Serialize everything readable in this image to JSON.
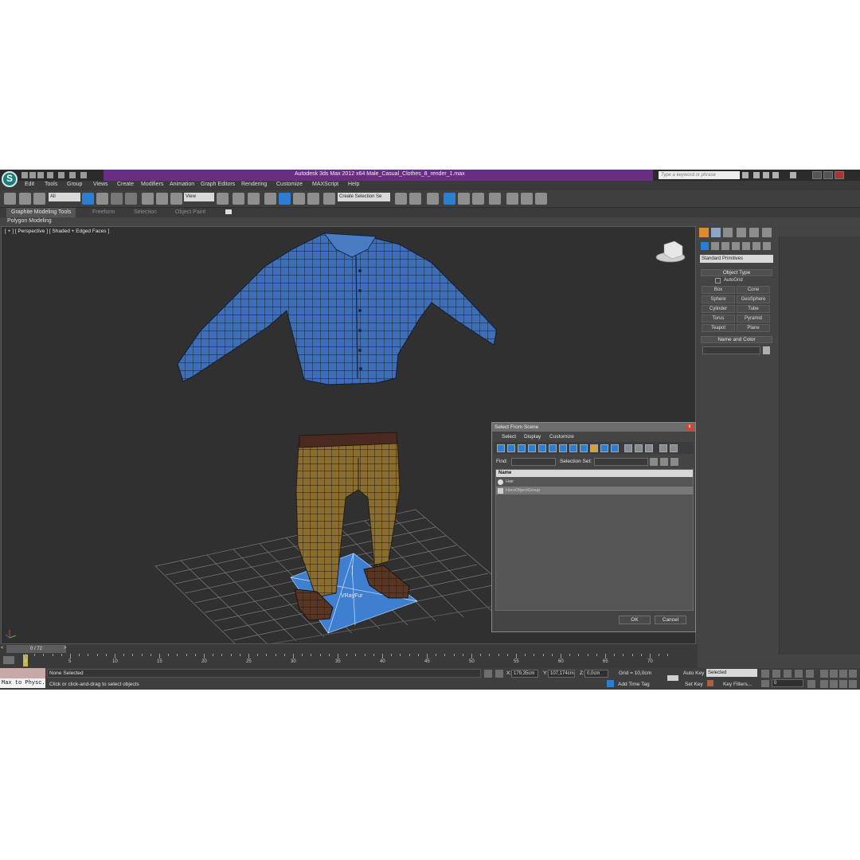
{
  "app": {
    "title": "Autodesk 3ds Max  2012 x64     Male_Casual_Clothes_8_render_1.max",
    "search_placeholder": "Type a keyword or phrase",
    "accent": "#6a2d86"
  },
  "menu": [
    "Edit",
    "Tools",
    "Group",
    "Views",
    "Create",
    "Modifiers",
    "Animation",
    "Graph Editors",
    "Rendering",
    "Customize",
    "MAXScript",
    "Help"
  ],
  "toolbar": {
    "filter_value": "All",
    "refcoord_value": "View",
    "selection_set_value": "Create Selection Se"
  },
  "ribbon": {
    "tabs": [
      "Graphite Modeling Tools",
      "Freeform",
      "Selection",
      "Object Paint"
    ],
    "sub_label": "Polygon Modeling"
  },
  "viewport": {
    "label": "[ + ] [ Perspective ] [ Shaded + Edged Faces ]",
    "object_label": "VRayFur"
  },
  "command_panel": {
    "category": "Standard Primitives",
    "object_type_title": "Object Type",
    "autogrid": "AutoGrid",
    "primitives": [
      "Box",
      "Cone",
      "Sphere",
      "GeoSphere",
      "Cylinder",
      "Tube",
      "Torus",
      "Pyramid",
      "Teapot",
      "Plane"
    ],
    "name_color_title": "Name and Color"
  },
  "dialog": {
    "title": "Select From Scene",
    "close": "x",
    "menu": [
      "Select",
      "Display",
      "Customize"
    ],
    "find_label": "Find:",
    "selection_set_label": "Selection Set:",
    "column_name": "Name",
    "rows": [
      "Hair",
      "HeroObjectGroup"
    ],
    "ok": "OK",
    "cancel": "Cancel"
  },
  "timeline": {
    "frame_display": "0 / 72",
    "ticks": [
      "0",
      "5",
      "10",
      "15",
      "20",
      "25",
      "30",
      "35",
      "40",
      "45",
      "50",
      "55",
      "60",
      "65",
      "70"
    ]
  },
  "status": {
    "maxscript": "Max to Physc.",
    "selection": "None Selected",
    "prompt": "Click or click-and-drag to select objects",
    "x_label": "X:",
    "x_value": "179,35cm",
    "y_label": "Y:",
    "y_value": "107,174cm",
    "z_label": "Z:",
    "z_value": "0,0cm",
    "grid": "Grid = 10,0cm",
    "add_time_tag": "Add Time Tag",
    "auto_key": "Auto Key",
    "set_key": "Set Key",
    "key_mode": "Selected",
    "key_filters": "Key Filters...",
    "current_frame": "0"
  },
  "colors": {
    "shirt": "#3d6fb8",
    "pants": "#8c6d30",
    "viewport_bg": "#303030",
    "selection_highlight": "#2a7fd4"
  }
}
